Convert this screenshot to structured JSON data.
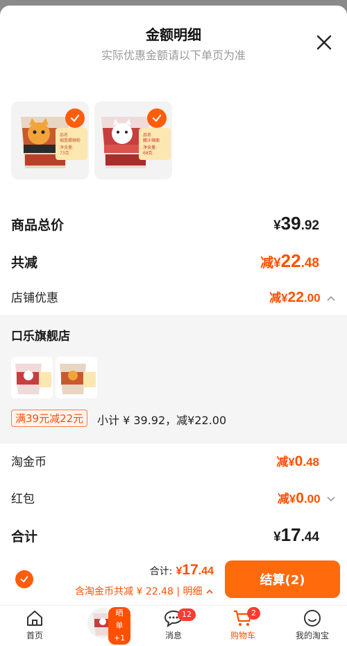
{
  "header": {
    "title": "金额明细",
    "subtitle": "实际优惠金额请以下单页为准"
  },
  "products": [
    {
      "name": "猫咪螺蛳粉",
      "tag_label": "品名",
      "tag_value": "烟熏螺蛳粉",
      "weight_label": "净含量:",
      "weight": "73克",
      "theme": "#c85a2f"
    },
    {
      "name": "醋汁辣面",
      "tag_label": "品名",
      "tag_value": "醋汁辣面",
      "weight_label": "净含量:",
      "weight": "68克",
      "theme": "#c83d3d"
    }
  ],
  "summary": {
    "total_label": "商品总价",
    "total_prefix": "¥",
    "total_int": "39",
    "total_dec": ".92",
    "discount_label": "共减",
    "discount_prefix": "减¥",
    "discount_int": "22",
    "discount_dec": ".48",
    "shop_discount_label": "店铺优惠",
    "shop_discount_prefix": "减¥",
    "shop_discount_int": "22",
    "shop_discount_dec": ".00"
  },
  "shop": {
    "name": "口乐旗舰店",
    "promo": "满39元减22元",
    "subtotal": "小计 ¥ 39.92，减¥22.00"
  },
  "extras": {
    "coins_label": "淘金币",
    "coins_prefix": "减¥",
    "coins_int": "0",
    "coins_dec": ".48",
    "redpack_label": "红包",
    "redpack_prefix": "减¥",
    "redpack_int": "0",
    "redpack_dec": ".00",
    "sum_label": "合计",
    "sum_prefix": "¥",
    "sum_int": "17",
    "sum_dec": ".44"
  },
  "checkout": {
    "total_label": "合计:",
    "total_prefix": "¥",
    "total_int": "17",
    "total_dec": ".44",
    "coins_note": "含淘金币共减 ¥ 22.48",
    "details_link": "明细",
    "button_label": "结算(2)"
  },
  "tabbar": {
    "items": [
      {
        "label": "首页",
        "icon": "home-icon"
      },
      {
        "label": "",
        "icon": "product-thumbnail",
        "badge": "晒单+1"
      },
      {
        "label": "消息",
        "icon": "message-icon",
        "badge": "12"
      },
      {
        "label": "购物车",
        "icon": "cart-icon",
        "badge": "2",
        "active": true
      },
      {
        "label": "我的淘宝",
        "icon": "profile-icon"
      }
    ]
  },
  "colors": {
    "accent": "#ff5000",
    "accent_button": "#ff6a0d",
    "muted": "#999999",
    "panel": "#f5f5f5"
  }
}
